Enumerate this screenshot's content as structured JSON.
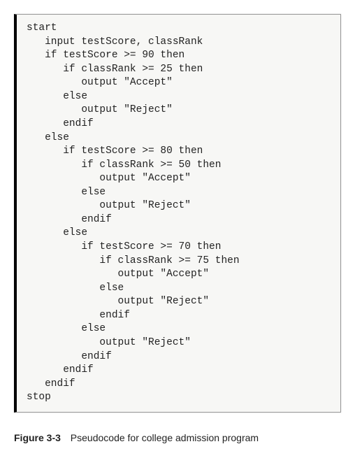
{
  "codebox": {
    "pseudocode": "start\n   input testScore, classRank\n   if testScore >= 90 then\n      if classRank >= 25 then\n         output \"Accept\"\n      else\n         output \"Reject\"\n      endif\n   else\n      if testScore >= 80 then\n         if classRank >= 50 then\n            output \"Accept\"\n         else\n            output \"Reject\"\n         endif\n      else\n         if testScore >= 70 then\n            if classRank >= 75 then\n               output \"Accept\"\n            else\n               output \"Reject\"\n            endif\n         else\n            output \"Reject\"\n         endif\n      endif\n   endif\nstop"
  },
  "caption": {
    "label": "Figure 3-3",
    "text": "Pseudocode for college admission program"
  }
}
